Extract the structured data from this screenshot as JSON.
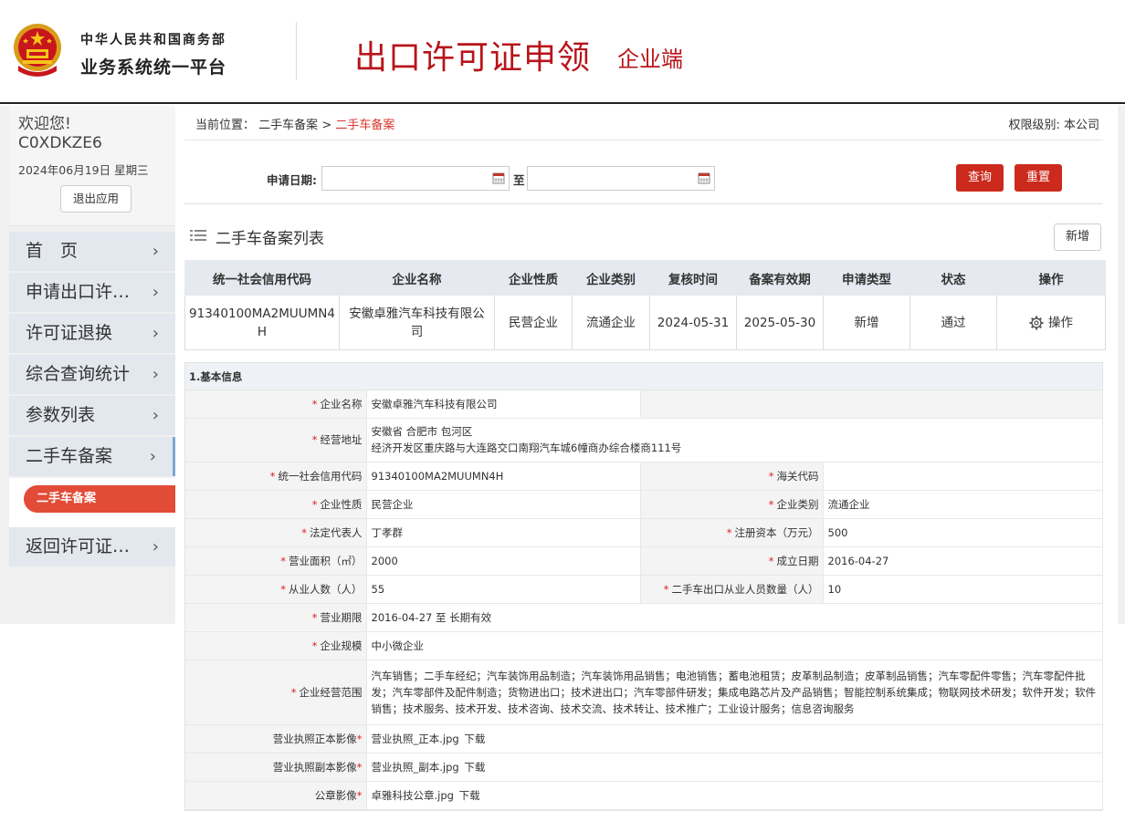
{
  "header": {
    "org_line1": "中华人民共和国商务部",
    "org_line2": "业务系统统一平台",
    "title": "出口许可证申领",
    "subtitle": "企业端"
  },
  "sidebar": {
    "welcome": "欢迎您!",
    "username": "C0XDKZE6",
    "date": "2024年06月19日 星期三",
    "logout_label": "退出应用",
    "items": [
      {
        "label": "首　页"
      },
      {
        "label": "申请出口许…"
      },
      {
        "label": "许可证退换"
      },
      {
        "label": "综合查询统计"
      },
      {
        "label": "参数列表"
      },
      {
        "label": "二手车备案"
      },
      {
        "label": "返回许可证…"
      }
    ],
    "sub_item": "二手车备案"
  },
  "breadcrumb": {
    "prefix": "当前位置：",
    "parent": "二手车备案",
    "separator": ">",
    "current": "二手车备案"
  },
  "permission": "权限级别: 本公司",
  "search": {
    "label": "申请日期:",
    "to_label": "至",
    "start_value": "",
    "end_value": "",
    "query_label": "查询",
    "reset_label": "重置"
  },
  "list": {
    "title": "二手车备案列表",
    "add_label": "新增",
    "columns": [
      "统一社会信用代码",
      "企业名称",
      "企业性质",
      "企业类别",
      "复核时间",
      "备案有效期",
      "申请类型",
      "状态",
      "操作"
    ],
    "rows": [
      {
        "credit_code": "91340100MA2MUUMN4H",
        "company": "安徽卓雅汽车科技有限公司",
        "nature": "民营企业",
        "category": "流通企业",
        "review_time": "2024-05-31",
        "valid_until": "2025-05-30",
        "apply_type": "新增",
        "status": "通过",
        "op_label": "操作"
      }
    ]
  },
  "detail": {
    "section_title": "1.基本信息",
    "company_name_label": "企业名称",
    "company_name": "安徽卓雅汽车科技有限公司",
    "address_label": "经营地址",
    "address_line1": "安徽省 合肥市 包河区",
    "address_line2": "经济开发区重庆路与大连路交口南翔汽车城6幢商办综合楼商111号",
    "credit_code_label": "统一社会信用代码",
    "credit_code": "91340100MA2MUUMN4H",
    "customs_code_label": "海关代码",
    "customs_code": "",
    "nature_label": "企业性质",
    "nature": "民营企业",
    "category_label": "企业类别",
    "category": "流通企业",
    "legal_rep_label": "法定代表人",
    "legal_rep": "丁孝群",
    "capital_label": "注册资本（万元）",
    "capital": "500",
    "area_label": "营业面积（㎡）",
    "area": "2000",
    "established_label": "成立日期",
    "established": "2016-04-27",
    "employees_label": "从业人数（人）",
    "employees": "55",
    "export_staff_label": "二手车出口从业人员数量（人）",
    "export_staff": "10",
    "term_label": "营业期限",
    "term": "2016-04-27 至 长期有效",
    "scale_label": "企业规模",
    "scale": "中小微企业",
    "scope_label": "企业经营范围",
    "scope": "汽车销售；二手车经纪；汽车装饰用品制造；汽车装饰用品销售；电池销售；蓄电池租赁；皮革制品制造；皮革制品销售；汽车零配件零售；汽车零配件批发；汽车零部件及配件制造；货物进出口；技术进出口；汽车零部件研发；集成电路芯片及产品销售；智能控制系统集成；物联网技术研发；软件开发；软件销售；技术服务、技术开发、技术咨询、技术交流、技术转让、技术推广；工业设计服务；信息咨询服务",
    "license_orig_label": "营业执照正本影像",
    "license_orig_file": "营业执照_正本.jpg",
    "license_copy_label": "营业执照副本影像",
    "license_copy_file": "营业执照_副本.jpg",
    "seal_label": "公章影像",
    "seal_file": "卓雅科技公章.jpg",
    "download_label": "下载"
  },
  "colors": {
    "brand_red": "#b8141b",
    "button_red": "#cc2a1c",
    "active_pill": "#e24b37",
    "nav_bg": "#e3e7ee"
  }
}
